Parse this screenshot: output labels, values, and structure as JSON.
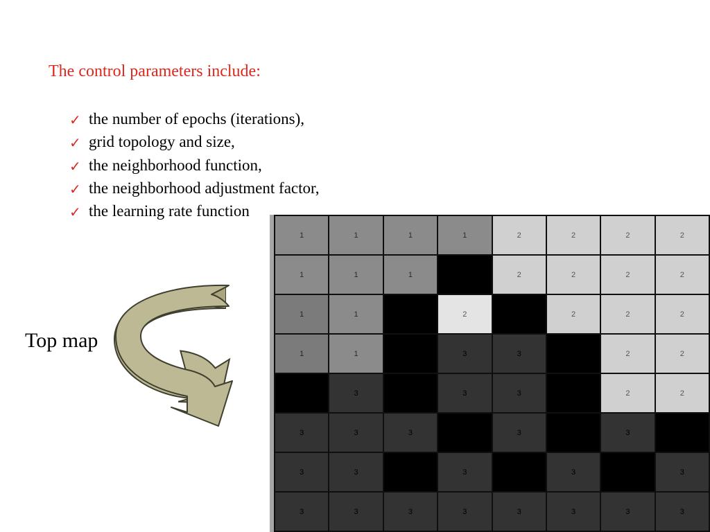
{
  "heading": "The control parameters include:",
  "bullets": [
    "the number of epochs (iterations),",
    "grid topology and size,",
    "the neighborhood function,",
    "the neighborhood adjustment factor,",
    "the learning rate function"
  ],
  "topmap_label": "Top map",
  "arrow_color": "#bdb994",
  "arrow_stroke": "#3f3f2f",
  "grid": {
    "rows": 8,
    "cols": 8,
    "cells": [
      [
        {
          "v": "1",
          "c": "c1"
        },
        {
          "v": "1",
          "c": "c1"
        },
        {
          "v": "1",
          "c": "c1"
        },
        {
          "v": "1",
          "c": "c1"
        },
        {
          "v": "2",
          "c": "c2"
        },
        {
          "v": "2",
          "c": "c2"
        },
        {
          "v": "2",
          "c": "c2"
        },
        {
          "v": "2",
          "c": "c2"
        }
      ],
      [
        {
          "v": "1",
          "c": "c1"
        },
        {
          "v": "1",
          "c": "c1"
        },
        {
          "v": "1",
          "c": "c1"
        },
        {
          "v": "",
          "c": "cb"
        },
        {
          "v": "2",
          "c": "c2"
        },
        {
          "v": "2",
          "c": "c2"
        },
        {
          "v": "2",
          "c": "c2"
        },
        {
          "v": "2",
          "c": "c2"
        }
      ],
      [
        {
          "v": "1",
          "c": "c1b"
        },
        {
          "v": "1",
          "c": "c1"
        },
        {
          "v": "",
          "c": "cb"
        },
        {
          "v": "2",
          "c": "c2w"
        },
        {
          "v": "",
          "c": "cb"
        },
        {
          "v": "2",
          "c": "c2"
        },
        {
          "v": "2",
          "c": "c2"
        },
        {
          "v": "2",
          "c": "c2"
        }
      ],
      [
        {
          "v": "1",
          "c": "c1b"
        },
        {
          "v": "1",
          "c": "c1"
        },
        {
          "v": "",
          "c": "cb"
        },
        {
          "v": "3",
          "c": "c3"
        },
        {
          "v": "3",
          "c": "c3"
        },
        {
          "v": "",
          "c": "cb"
        },
        {
          "v": "2",
          "c": "c2"
        },
        {
          "v": "2",
          "c": "c2"
        }
      ],
      [
        {
          "v": "",
          "c": "cb"
        },
        {
          "v": "3",
          "c": "c3"
        },
        {
          "v": "",
          "c": "cb"
        },
        {
          "v": "3",
          "c": "c3"
        },
        {
          "v": "3",
          "c": "c3"
        },
        {
          "v": "",
          "c": "cb"
        },
        {
          "v": "2",
          "c": "c2"
        },
        {
          "v": "2",
          "c": "c2"
        }
      ],
      [
        {
          "v": "3",
          "c": "c3"
        },
        {
          "v": "3",
          "c": "c3"
        },
        {
          "v": "3",
          "c": "c3"
        },
        {
          "v": "",
          "c": "cb"
        },
        {
          "v": "3",
          "c": "c3"
        },
        {
          "v": "",
          "c": "cb"
        },
        {
          "v": "3",
          "c": "c3"
        },
        {
          "v": "",
          "c": "cb"
        }
      ],
      [
        {
          "v": "3",
          "c": "c3"
        },
        {
          "v": "3",
          "c": "c3"
        },
        {
          "v": "",
          "c": "cb"
        },
        {
          "v": "3",
          "c": "c3"
        },
        {
          "v": "",
          "c": "cb"
        },
        {
          "v": "3",
          "c": "c3"
        },
        {
          "v": "",
          "c": "cb"
        },
        {
          "v": "3",
          "c": "c3"
        }
      ],
      [
        {
          "v": "3",
          "c": "c3"
        },
        {
          "v": "3",
          "c": "c3"
        },
        {
          "v": "3",
          "c": "c3"
        },
        {
          "v": "3",
          "c": "c3"
        },
        {
          "v": "3",
          "c": "c3"
        },
        {
          "v": "3",
          "c": "c3"
        },
        {
          "v": "3",
          "c": "c3"
        },
        {
          "v": "3",
          "c": "c3"
        }
      ]
    ]
  }
}
